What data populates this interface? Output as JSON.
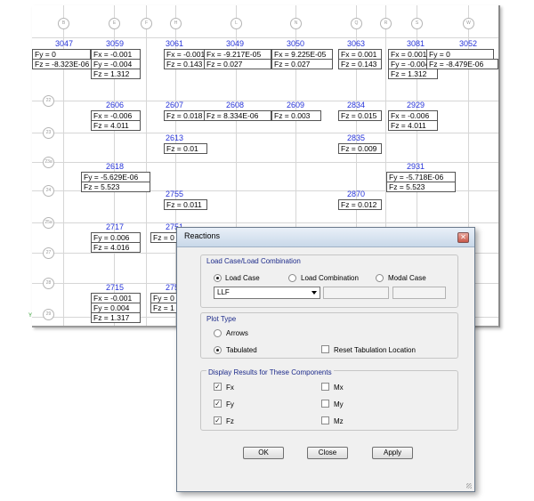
{
  "view": {
    "bubbles_top": [
      "B",
      "E",
      "F",
      "H",
      "L",
      "N",
      "Q",
      "R",
      "S",
      "W"
    ],
    "bubbles_left": [
      "22",
      "23",
      "23a",
      "24",
      "25a",
      "27",
      "28",
      "29"
    ],
    "axis_label": "Y",
    "nodes": [
      "3047",
      "3059",
      "3061",
      "3049",
      "3050",
      "3063",
      "3081",
      "3052",
      "2606",
      "2607",
      "2608",
      "2609",
      "2834",
      "2929",
      "2613",
      "2835",
      "2618",
      "2931",
      "2755",
      "2870",
      "2717",
      "2751",
      "2715",
      "275"
    ],
    "values": [
      "Fy = 0",
      "Fz = -8.323E-06",
      "Fx = -0.001",
      "Fy = -0.004",
      "Fz = 1.312",
      "Fx = -0.001",
      "Fz = 0.143",
      "Fx = -9.217E-05",
      "Fz = 0.027",
      "Fx = 9.225E-05",
      "Fz = 0.027",
      "Fx = 0.001",
      "Fz = 0.143",
      "Fx = 0.001",
      "Fy = -0.004",
      "Fz = 1.312",
      "Fy = 0",
      "Fz = -8.479E-06",
      "Fx = -0.006",
      "Fz = 4.011",
      "Fz = 0.018",
      "Fz = 8.334E-06",
      "Fz = 0.003",
      "Fz = 0.015",
      "Fx = -0.006",
      "Fz = 4.011",
      "Fz = 0.01",
      "Fz = 0.009",
      "Fy = -5.629E-06",
      "Fz = 5.523",
      "Fy = -5.718E-06",
      "Fz = 5.523",
      "Fz = 0.011",
      "Fz = 0.012",
      "Fy = 0.006",
      "Fz = 4.016",
      "Fz = 0",
      "Fx = -0.001",
      "Fy = 0.004",
      "Fz = 1.317",
      "Fy = 0",
      "Fz = 1"
    ]
  },
  "dialog": {
    "title": "Reactions",
    "close_glyph": "✕",
    "group_load": "Load Case/Load Combination",
    "opt_load_case": "Load Case",
    "opt_load_combo": "Load Combination",
    "opt_modal": "Modal Case",
    "selected_case": "LLF",
    "group_plot": "Plot Type",
    "opt_arrows": "Arrows",
    "opt_tabulated": "Tabulated",
    "reset_tab": "Reset Tabulation Location",
    "group_components": "Display Results for These Components",
    "fx": "Fx",
    "fy": "Fy",
    "fz": "Fz",
    "mx": "Mx",
    "my": "My",
    "mz": "Mz",
    "check_glyph": "✓",
    "ok": "OK",
    "close": "Close",
    "apply": "Apply"
  }
}
